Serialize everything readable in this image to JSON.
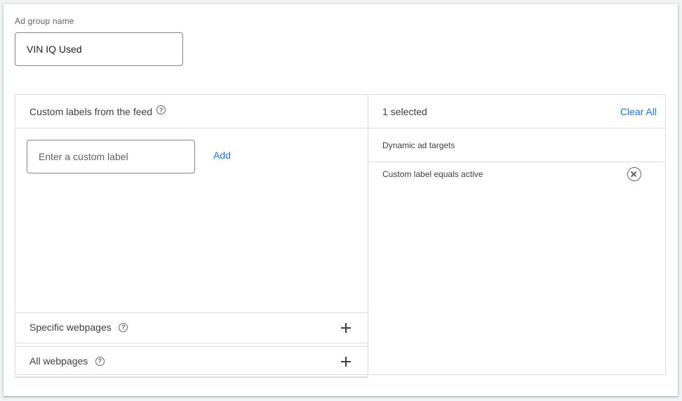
{
  "ad_group": {
    "label": "Ad group name",
    "value": "VIN IQ Used"
  },
  "left_panel": {
    "header": "Custom labels from the feed",
    "header_icon": "help-icon",
    "input_placeholder": "Enter a custom label",
    "add_label": "Add",
    "sections": [
      {
        "label": "Specific webpages",
        "icon": "help-icon",
        "action_icon": "plus-icon"
      },
      {
        "label": "All webpages",
        "icon": "help-icon",
        "action_icon": "plus-icon"
      }
    ]
  },
  "right_panel": {
    "selected_count": "1 selected",
    "clear_all": "Clear All",
    "group_title": "Dynamic ad targets",
    "targets": [
      {
        "label": "Custom label equals active",
        "action_icon": "remove-icon"
      }
    ]
  },
  "colors": {
    "accent": "#1a73e8",
    "border": "#dadce0",
    "text": "#3c4043"
  }
}
